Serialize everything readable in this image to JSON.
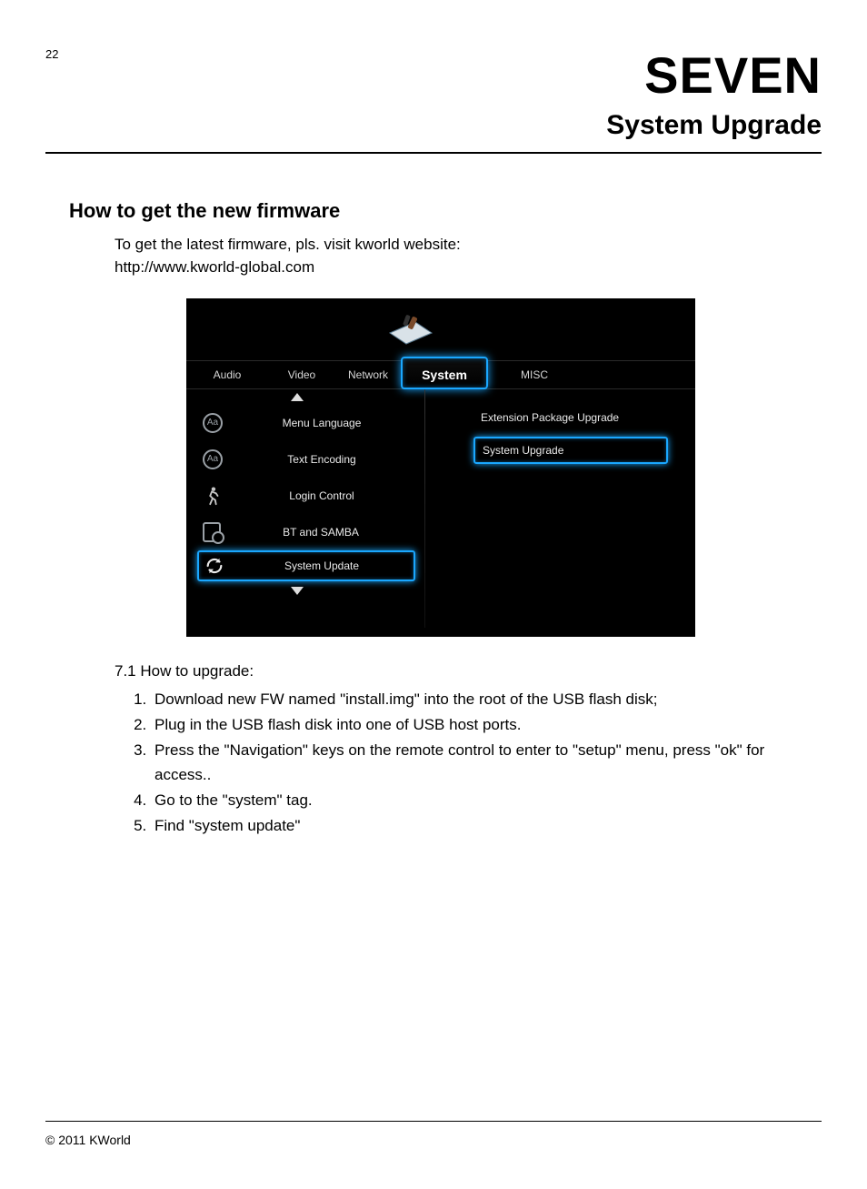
{
  "page_number": "22",
  "chapter_title": "SEVEN",
  "chapter_subtitle": "System Upgrade",
  "section_heading": "How to get the new firmware",
  "intro_text": "To get the latest firmware, pls. visit kworld website:",
  "intro_url": "http://www.kworld-global.com",
  "sub_section": "7.1 How to upgrade:",
  "steps": [
    "Download new FW named \"install.img\" into the root of the USB flash disk;",
    "Plug in the USB flash disk into one of USB host ports.",
    "Press the \"Navigation\" keys on the remote control to enter to \"setup\" menu, press \"ok\" for access..",
    "Go to the \"system\" tag.",
    "Find \"system update\""
  ],
  "footer": "© 2011 KWorld",
  "ui": {
    "tabs": {
      "audio": "Audio",
      "video": "Video",
      "network": "Network",
      "system": "System",
      "misc": "MISC"
    },
    "left_menu": {
      "item0": "Menu Language",
      "item1": "Text Encoding",
      "item2": "Login Control",
      "item3": "BT and SAMBA",
      "item4": "System Update"
    },
    "right_menu": {
      "item0": "Extension Package Upgrade",
      "item1": "System Upgrade"
    }
  }
}
